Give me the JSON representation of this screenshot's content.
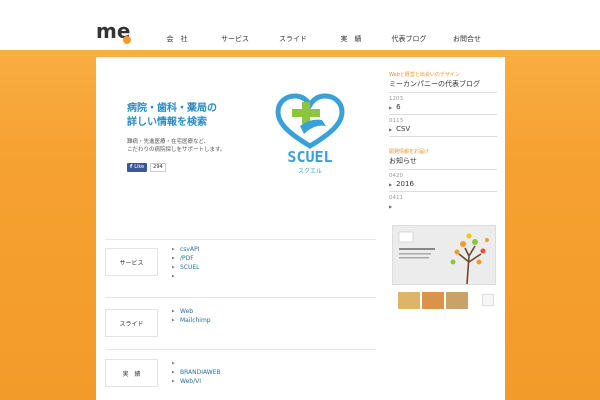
{
  "header": {
    "nav": [
      {
        "label": "会　社"
      },
      {
        "label": "サービス"
      },
      {
        "label": "スライド"
      },
      {
        "label": "実　績"
      },
      {
        "label": "代表ブログ"
      },
      {
        "label": "お問合せ"
      }
    ]
  },
  "hero": {
    "title_line1": "病院・歯科・薬局の",
    "title_line2": "詳しい情報を検索",
    "desc_line1": "難病・先進医療・在宅医療など、",
    "desc_line2": "こだわりの病院探しをサポートします。",
    "like_label": "Like",
    "like_count": "294",
    "scuel_name": "SCUEL",
    "scuel_kana": "スクエル"
  },
  "sections": [
    {
      "label": "サービス",
      "links": [
        "csvAPI",
        "/PDF",
        "SCUEL",
        ""
      ]
    },
    {
      "label": "スライド",
      "links": [
        "Web",
        "Mailchimp"
      ]
    },
    {
      "label": "実　績",
      "links": [
        "",
        "BRANDIAWEB",
        "Web/VI"
      ]
    }
  ],
  "sidebar": {
    "blog": {
      "subtitle": "Webと経営と出会いのデザイン",
      "title": "ミーカンパニーの代表ブログ",
      "entries": [
        {
          "date": "1203",
          "text": "6"
        },
        {
          "date": "0113",
          "text": "CSV"
        }
      ]
    },
    "news": {
      "subtitle": "開発情報をお届け",
      "title": "お知らせ",
      "entries": [
        {
          "date": "0420",
          "text": "2016"
        },
        {
          "date": "0411",
          "text": ""
        }
      ]
    }
  },
  "colors": {
    "accent_orange": "#f39b2a",
    "hero_blue": "#2b8cc4",
    "scuel_blue": "#3aa0d8",
    "scuel_green": "#8cc63f"
  }
}
